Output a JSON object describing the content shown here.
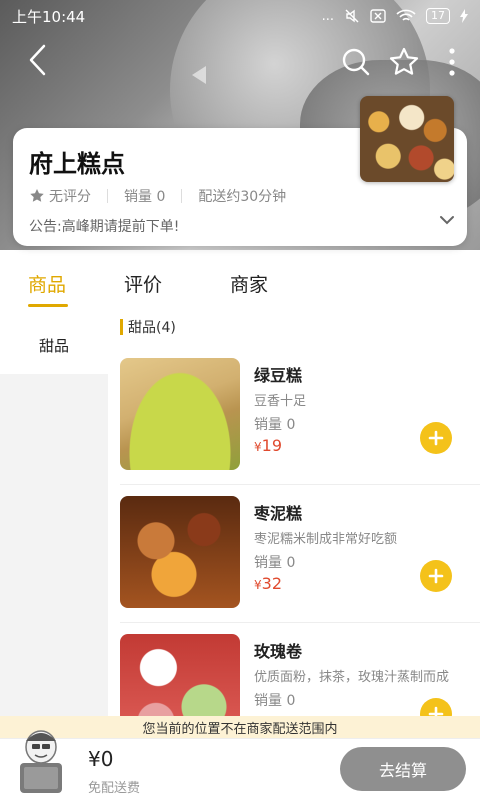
{
  "status_bar": {
    "time": "上午10:44",
    "signal": "...",
    "battery": "17"
  },
  "shop": {
    "name": "府上糕点",
    "rating": "无评分",
    "sales": "销量 0",
    "delivery_time": "配送约30分钟",
    "notice": "公告:高峰期请提前下单!"
  },
  "tabs": [
    {
      "label": "商品"
    },
    {
      "label": "评价"
    },
    {
      "label": "商家"
    }
  ],
  "sidebar": {
    "items": [
      {
        "label": "甜品"
      }
    ]
  },
  "category": {
    "title": "甜品(4)"
  },
  "products": [
    {
      "name": "绿豆糕",
      "desc": "豆香十足",
      "sales": "销量 0",
      "price": "19"
    },
    {
      "name": "枣泥糕",
      "desc": "枣泥糯米制成非常好吃额",
      "sales": "销量 0",
      "price": "32"
    },
    {
      "name": "玫瑰卷",
      "desc": "优质面粉，抹茶，玫瑰汁蒸制而成",
      "sales": "销量 0",
      "price": ""
    }
  ],
  "currency_symbol": "¥",
  "banner": {
    "text": "您当前的位置不在商家配送范围内"
  },
  "cart": {
    "total": "¥0",
    "delivery_fee": "免配送费",
    "checkout_label": "去结算"
  },
  "colors": {
    "accent": "#e0a800",
    "add_button": "#f4c21a",
    "price": "#e04a2e",
    "checkout_bg": "#8f8f8f"
  },
  "icons": [
    "back-icon",
    "search-icon",
    "star-outline-icon",
    "more-icon",
    "star-icon",
    "chevron-down-icon",
    "plus-icon",
    "cart-mascot-icon"
  ]
}
